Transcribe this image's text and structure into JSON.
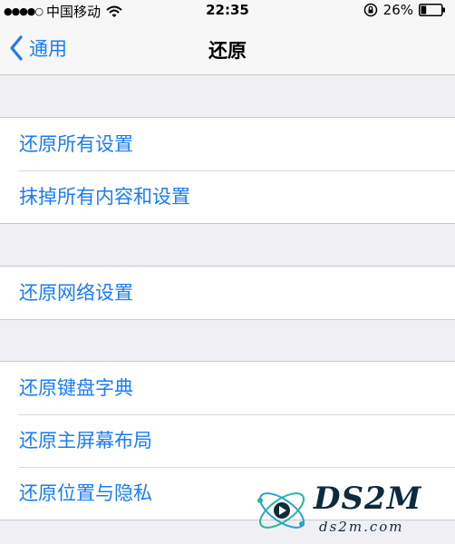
{
  "status_bar": {
    "signal_dots": "●●●●○",
    "carrier": "中国移动",
    "time": "22:35",
    "battery_percent": "26%",
    "battery_level": 0.26,
    "icons": [
      "wifi-icon",
      "rotation-lock-icon",
      "battery-icon"
    ]
  },
  "nav": {
    "back_label": "通用",
    "title": "还原",
    "back_icon": "chevron-left-icon"
  },
  "groups": [
    {
      "items": [
        {
          "label": "还原所有设置"
        },
        {
          "label": "抹掉所有内容和设置"
        }
      ]
    },
    {
      "items": [
        {
          "label": "还原网络设置"
        }
      ]
    },
    {
      "items": [
        {
          "label": "还原键盘字典"
        },
        {
          "label": "还原主屏幕布局"
        },
        {
          "label": "还原位置与隐私"
        }
      ]
    }
  ],
  "watermark": {
    "text": "DS2M",
    "subtext": "ds2m.com"
  },
  "colors": {
    "accent": "#1a7cf5",
    "background": "#efeff4",
    "cell": "#ffffff",
    "separator": "#c8c7cc"
  }
}
